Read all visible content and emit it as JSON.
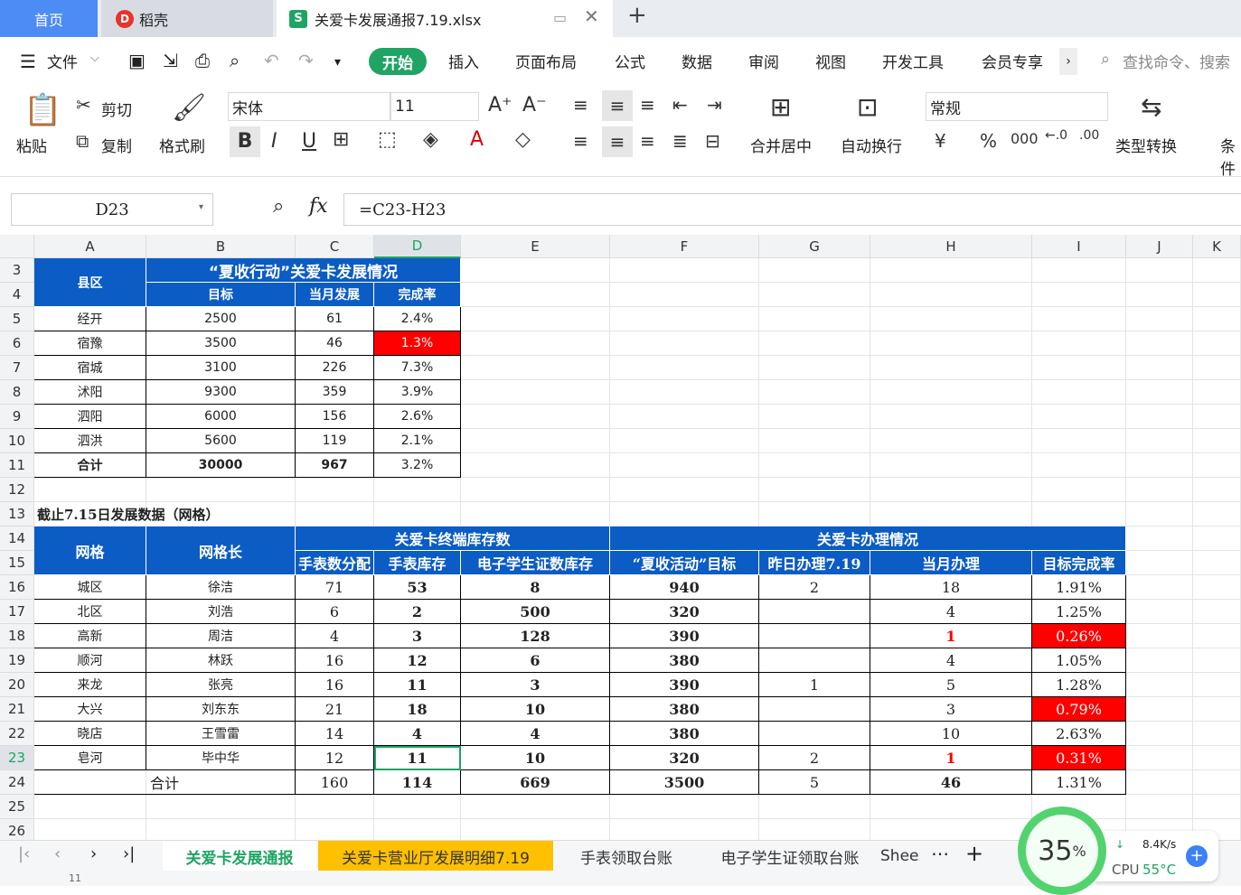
{
  "tabs": {
    "home": "首页",
    "daoke": "稻壳",
    "file": "关爱卡发展通报7.19.xlsx",
    "daoke_logo": "D",
    "file_logo": "S"
  },
  "menu": {
    "file": "文件",
    "start": "开始",
    "items": [
      "插入",
      "页面布局",
      "公式",
      "数据",
      "审阅",
      "视图",
      "开发工具",
      "会员专享"
    ],
    "search": "查找命令、搜索"
  },
  "ribbon": {
    "paste": "粘贴",
    "cut": "剪切",
    "copy": "复制",
    "format_painter": "格式刷",
    "font": "宋体",
    "size": "11",
    "merge": "合并居中",
    "wrap": "自动换行",
    "numfmt": "常规",
    "convert": "类型转换",
    "cond": "条件"
  },
  "formula": {
    "cell": "D23",
    "fx": "fx",
    "value": "=C23-H23"
  },
  "columns": [
    "A",
    "B",
    "C",
    "D",
    "E",
    "F",
    "G",
    "H",
    "I",
    "J",
    "K"
  ],
  "rows": [
    "3",
    "4",
    "5",
    "6",
    "7",
    "8",
    "9",
    "10",
    "11",
    "12",
    "13",
    "14",
    "15",
    "16",
    "17",
    "18",
    "19",
    "20",
    "21",
    "22",
    "23",
    "24",
    "25",
    "26"
  ],
  "table1": {
    "title": "“夏收行动”关爱卡发展情况",
    "county_header": "县区",
    "headers": [
      "目标",
      "当月发展",
      "完成率"
    ],
    "rows": [
      [
        "经开",
        "2500",
        "61",
        "2.4%"
      ],
      [
        "宿豫",
        "3500",
        "46",
        "1.3%"
      ],
      [
        "宿城",
        "3100",
        "226",
        "7.3%"
      ],
      [
        "沭阳",
        "9300",
        "359",
        "3.9%"
      ],
      [
        "泗阳",
        "6000",
        "156",
        "2.6%"
      ],
      [
        "泗洪",
        "5600",
        "119",
        "2.1%"
      ],
      [
        "合计",
        "30000",
        "967",
        "3.2%"
      ]
    ]
  },
  "table2": {
    "title": "截止7.15日发展数据（网格）",
    "grid_header": "网格",
    "leader_header": "网格长",
    "group1": "关爱卡终端库存数",
    "group2": "关爱卡办理情况",
    "subheaders": [
      "手表数分配",
      "手表库存",
      "电子学生证数库存",
      "“夏收活动”目标",
      "昨日办理7.19",
      "当月办理",
      "目标完成率"
    ],
    "rows": [
      [
        "城区",
        "徐洁",
        "71",
        "53",
        "8",
        "940",
        "2",
        "18",
        "1.91%"
      ],
      [
        "北区",
        "刘浩",
        "6",
        "2",
        "500",
        "320",
        "",
        "4",
        "1.25%"
      ],
      [
        "高新",
        "周洁",
        "4",
        "3",
        "128",
        "390",
        "",
        "1",
        "0.26%"
      ],
      [
        "顺河",
        "林跃",
        "16",
        "12",
        "6",
        "380",
        "",
        "4",
        "1.05%"
      ],
      [
        "来龙",
        "张亮",
        "16",
        "11",
        "3",
        "390",
        "1",
        "5",
        "1.28%"
      ],
      [
        "大兴",
        "刘东东",
        "21",
        "18",
        "10",
        "380",
        "",
        "3",
        "0.79%"
      ],
      [
        "晓店",
        "王雪雷",
        "14",
        "4",
        "4",
        "380",
        "",
        "10",
        "2.63%"
      ],
      [
        "皂河",
        "毕中华",
        "12",
        "11",
        "10",
        "320",
        "2",
        "1",
        "0.31%"
      ]
    ],
    "total": [
      "合计",
      "160",
      "114",
      "669",
      "3500",
      "5",
      "46",
      "1.31%"
    ]
  },
  "sheets": [
    "关爱卡发展通报",
    "关爱卡营业厅发展明细7.19",
    "手表领取台账",
    "电子学生证领取台账",
    "Shee"
  ],
  "monitor": {
    "percent": "35",
    "unit": "%",
    "net": "8.4K/s",
    "cpu_label": "CPU",
    "cpu_value": "55°C"
  },
  "status": {
    "zoom": "11"
  },
  "colors": {
    "header_blue": "#0b5cc4",
    "alert_red": "#ff0000",
    "wps_green": "#1fa463"
  }
}
